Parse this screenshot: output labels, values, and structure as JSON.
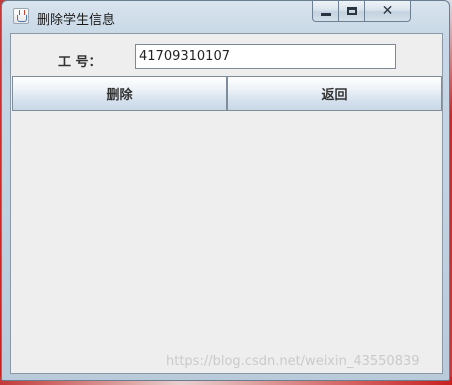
{
  "window": {
    "title": "删除学生信息",
    "icon": "java-cup-icon",
    "controls": {
      "minimize": "minimize-icon",
      "maximize": "maximize-icon",
      "close": "close-icon"
    }
  },
  "form": {
    "id_label": "工    号：",
    "id_value": "41709310107"
  },
  "buttons": {
    "delete_label": "删除",
    "back_label": "返回"
  },
  "watermark": "https://blog.csdn.net/weixin_43550839"
}
